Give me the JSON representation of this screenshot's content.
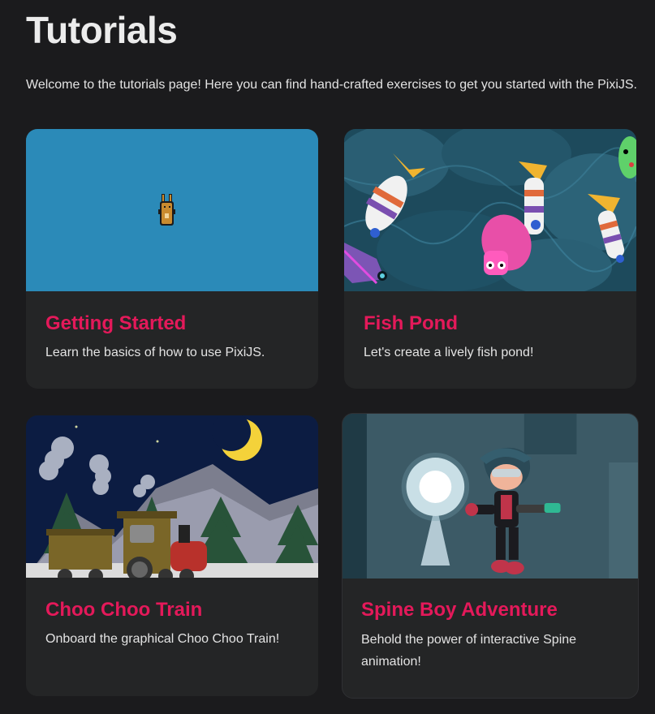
{
  "page": {
    "title": "Tutorials",
    "intro": "Welcome to the tutorials page! Here you can find hand-crafted exercises to get you started with the PixiJS."
  },
  "tutorials": [
    {
      "title": "Getting Started",
      "description": "Learn the basics of how to use PixiJS.",
      "image": "bunny-sprite"
    },
    {
      "title": "Fish Pond",
      "description": "Let's create a lively fish pond!",
      "image": "fish-pond-scene"
    },
    {
      "title": "Choo Choo Train",
      "description": "Onboard the graphical Choo Choo Train!",
      "image": "night-train-scene"
    },
    {
      "title": "Spine Boy Adventure",
      "description": "Behold the power of interactive Spine animation!",
      "image": "spine-boy-scene"
    }
  ],
  "colors": {
    "background": "#1b1b1d",
    "card": "#242526",
    "accent": "#e4195a",
    "text": "#e3e3e3"
  }
}
